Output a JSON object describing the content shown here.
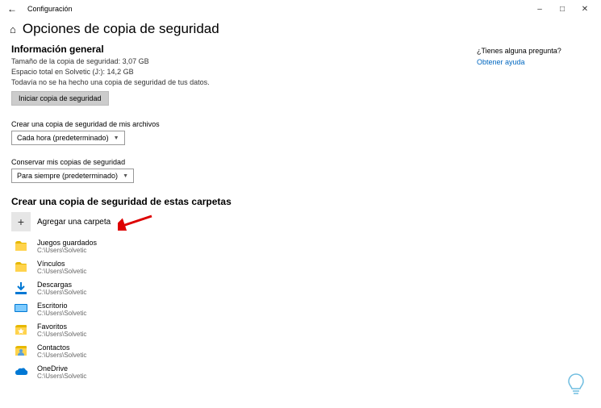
{
  "window": {
    "title": "Configuración"
  },
  "header": {
    "title": "Opciones de copia de seguridad"
  },
  "overview": {
    "heading": "Información general",
    "size_line": "Tamaño de la copia de seguridad: 3,07 GB",
    "space_line": "Espacio total en Solvetic (J:): 14,2 GB",
    "status_line": "Todavía no se ha hecho una copia de seguridad de tus datos.",
    "start_button": "Iniciar copia de seguridad"
  },
  "frequency": {
    "label": "Crear una copia de seguridad de mis archivos",
    "value": "Cada hora (predeterminado)"
  },
  "retention": {
    "label": "Conservar mis copias de seguridad",
    "value": "Para siempre (predeterminado)"
  },
  "folders": {
    "heading": "Crear una copia de seguridad de estas carpetas",
    "add_label": "Agregar una carpeta",
    "items": [
      {
        "name": "Juegos guardados",
        "path": "C:\\Users\\Solvetic",
        "icon": "folder"
      },
      {
        "name": "Vínculos",
        "path": "C:\\Users\\Solvetic",
        "icon": "folder"
      },
      {
        "name": "Descargas",
        "path": "C:\\Users\\Solvetic",
        "icon": "download"
      },
      {
        "name": "Escritorio",
        "path": "C:\\Users\\Solvetic",
        "icon": "desktop"
      },
      {
        "name": "Favoritos",
        "path": "C:\\Users\\Solvetic",
        "icon": "favorites"
      },
      {
        "name": "Contactos",
        "path": "C:\\Users\\Solvetic",
        "icon": "contacts"
      },
      {
        "name": "OneDrive",
        "path": "C:\\Users\\Solvetic",
        "icon": "onedrive"
      }
    ]
  },
  "help": {
    "question": "¿Tienes alguna pregunta?",
    "link": "Obtener ayuda"
  }
}
